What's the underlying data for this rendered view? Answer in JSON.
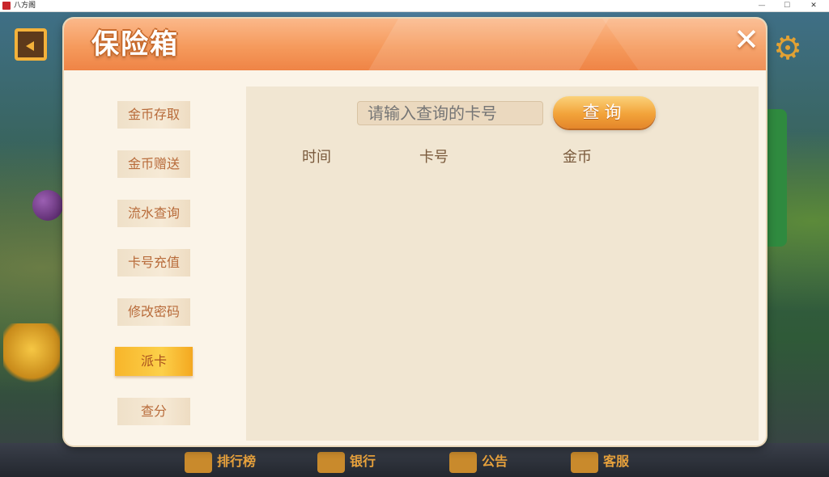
{
  "window": {
    "title": "八方阁",
    "min_glyph": "—",
    "max_glyph": "☐",
    "close_glyph": "✕"
  },
  "background": {
    "gear_glyph": "⚙",
    "bottom_nav": [
      {
        "label": "排行榜",
        "icon": "trophy-icon"
      },
      {
        "label": "银行",
        "icon": "bank-icon"
      },
      {
        "label": "公告",
        "icon": "megaphone-icon"
      },
      {
        "label": "客服",
        "icon": "support-icon"
      }
    ]
  },
  "dialog": {
    "title": "保险箱",
    "close_glyph": "✕",
    "tabs": [
      {
        "label": "金币存取",
        "active": false
      },
      {
        "label": "金币赠送",
        "active": false
      },
      {
        "label": "流水查询",
        "active": false
      },
      {
        "label": "卡号充值",
        "active": false
      },
      {
        "label": "修改密码",
        "active": false
      },
      {
        "label": "派卡",
        "active": true
      },
      {
        "label": "查分",
        "active": false
      }
    ],
    "search": {
      "placeholder": "请输入查询的卡号",
      "value": "",
      "button_label": "查询"
    },
    "table": {
      "columns": [
        "时间",
        "卡号",
        "金币"
      ],
      "rows": []
    }
  },
  "colors": {
    "header_orange": "#f59a5c",
    "active_tab": "#fcd04a",
    "tab_text": "#b86b3a",
    "panel_bg": "#f1e6d2",
    "button_orange": "#f2a33a"
  }
}
